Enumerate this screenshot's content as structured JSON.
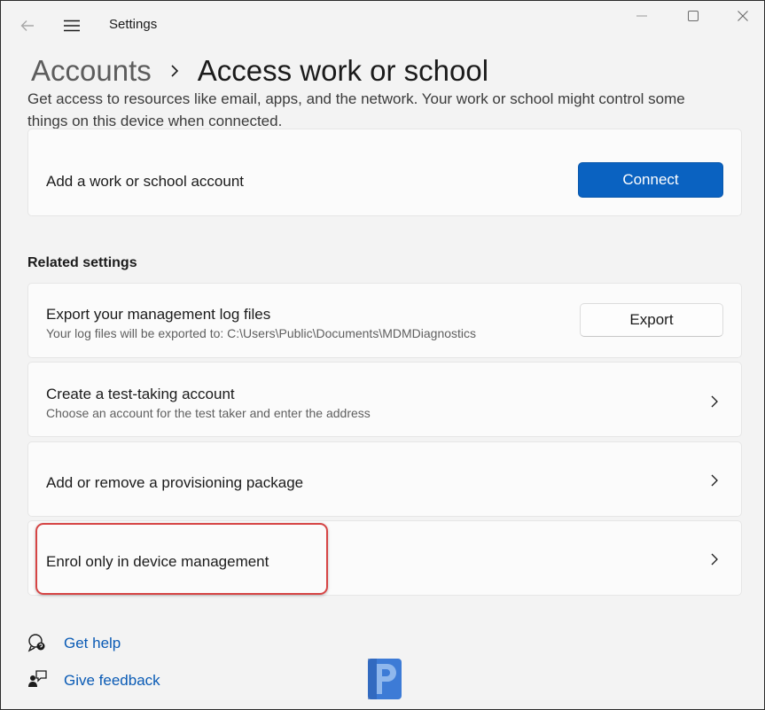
{
  "window": {
    "title": "Settings"
  },
  "breadcrumb": {
    "parent": "Accounts",
    "current": "Access work or school"
  },
  "description": "Get access to resources like email, apps, and the network. Your work or school might control some things on this device when connected.",
  "add_account": {
    "label": "Add a work or school account",
    "button": "Connect"
  },
  "related": {
    "heading": "Related settings",
    "export": {
      "title": "Export your management log files",
      "subtitle": "Your log files will be exported to: C:\\Users\\Public\\Documents\\MDMDiagnostics",
      "button": "Export"
    },
    "test_account": {
      "title": "Create a test-taking account",
      "subtitle": "Choose an account for the test taker and enter the address"
    },
    "provisioning": {
      "title": "Add or remove a provisioning package"
    },
    "enrol": {
      "title": "Enrol only in device management"
    }
  },
  "links": {
    "help": "Get help",
    "feedback": "Give feedback"
  },
  "icons": {
    "back": "back-arrow-icon",
    "menu": "hamburger-menu-icon",
    "minimize": "minimize-icon",
    "maximize": "maximize-icon",
    "close": "close-icon",
    "chevron": "chevron-right-icon",
    "help": "help-icon",
    "feedback": "feedback-icon"
  },
  "colors": {
    "accent": "#0a62c1",
    "link": "#0a5bb5",
    "highlight": "#d64545"
  }
}
